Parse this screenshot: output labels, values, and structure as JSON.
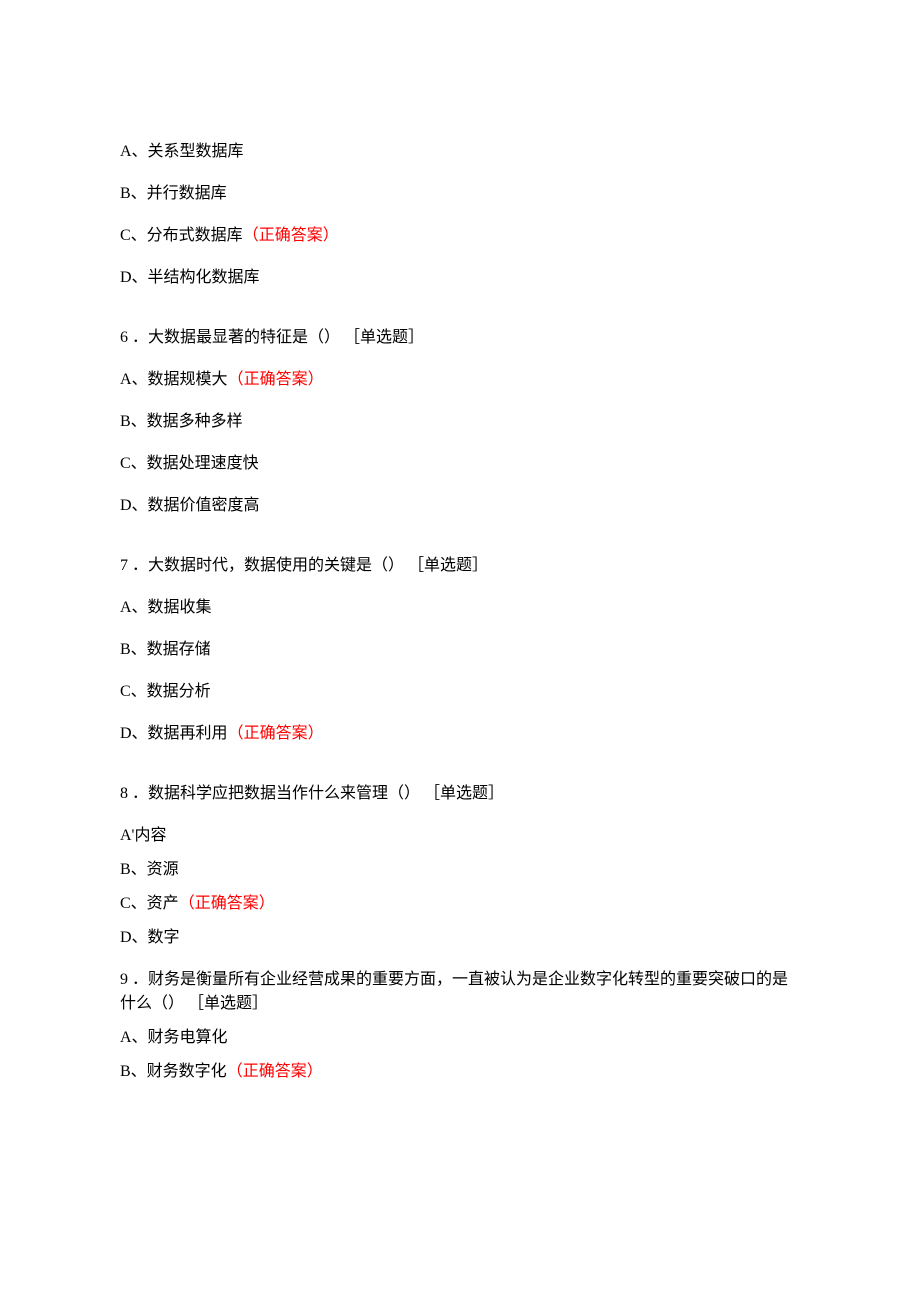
{
  "correct_label": "（正确答案）",
  "q5": {
    "options": {
      "A": "A、关系型数据库",
      "B": "B、并行数据库",
      "C": "C、分布式数据库",
      "D": "D、半结构化数据库"
    },
    "correct": "C"
  },
  "q6": {
    "stem": "6 ．大数据最显著的特征是（） ［单选题］",
    "options": {
      "A": "A、数据规模大",
      "B": "B、数据多种多样",
      "C": "C、数据处理速度快",
      "D": "D、数据价值密度高"
    },
    "correct": "A"
  },
  "q7": {
    "stem": "7 ．大数据时代，数据使用的关键是（） ［单选题］",
    "options": {
      "A": "A、数据收集",
      "B": "B、数据存储",
      "C": "C、数据分析",
      "D": "D、数据再利用"
    },
    "correct": "D"
  },
  "q8": {
    "stem": "8 ．数据科学应把数据当作什么来管理（） ［单选题］",
    "options": {
      "A": "A'内容",
      "B": "B、资源",
      "C": "C、资产",
      "D": "D、数字"
    },
    "correct": "C"
  },
  "q9": {
    "stem": "9 ．财务是衡量所有企业经营成果的重要方面，一直被认为是企业数字化转型的重要突破口的是什么（） ［单选题］",
    "options": {
      "A": "A、财务电算化",
      "B": "B、财务数字化"
    },
    "correct": "B"
  }
}
